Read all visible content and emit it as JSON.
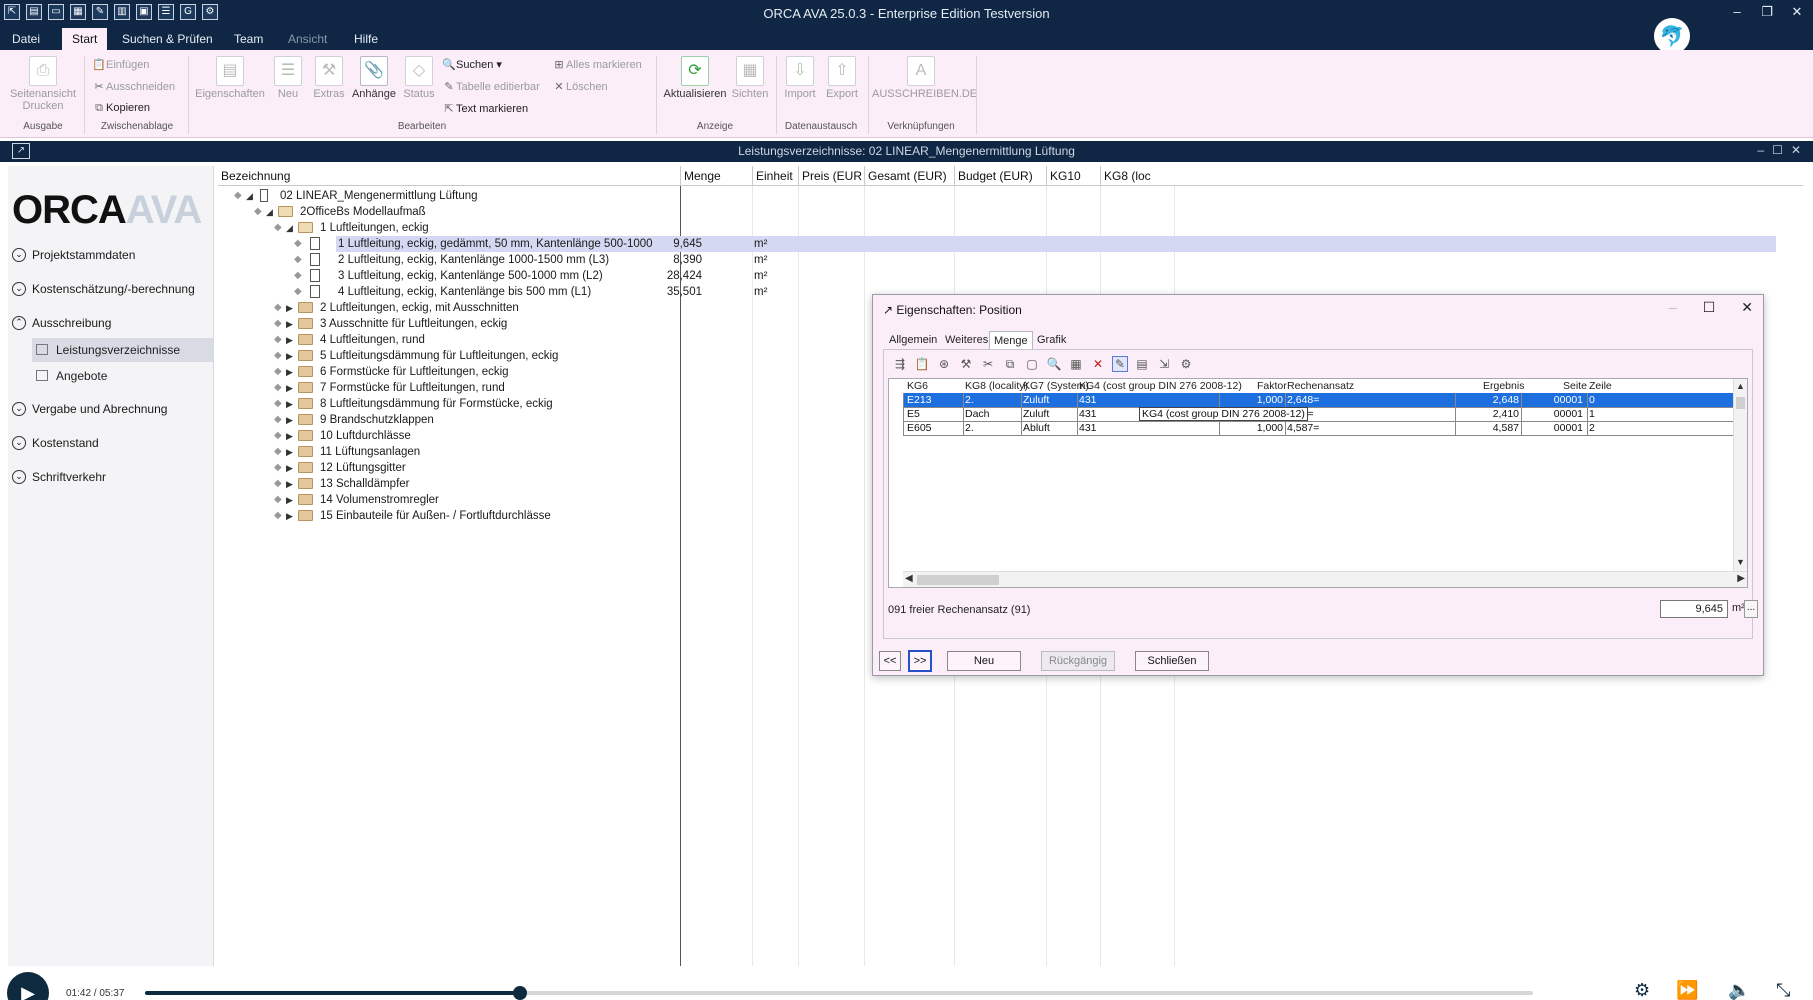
{
  "window": {
    "title": "ORCA AVA 25.0.3 - Enterprise Edition Testversion",
    "controls": [
      "–",
      "❐",
      "✕"
    ]
  },
  "menu": {
    "tabs": [
      {
        "label": "Datei",
        "state": "normal"
      },
      {
        "label": "Start",
        "state": "active"
      },
      {
        "label": "Suchen & Prüfen",
        "state": "normal"
      },
      {
        "label": "Team",
        "state": "normal"
      },
      {
        "label": "Ansicht",
        "state": "disabled"
      },
      {
        "label": "Hilfe",
        "state": "normal"
      }
    ]
  },
  "ribbon": {
    "seitenansicht": "Seitenansicht Drucken",
    "einfuegen": "Einfügen",
    "ausschneiden": "Ausschneiden",
    "kopieren": "Kopieren",
    "eigenschaften": "Eigenschaften",
    "neu": "Neu",
    "extras": "Extras",
    "anhaenge": "Anhänge",
    "status": "Status",
    "suchen": "Suchen",
    "tabelle": "Tabelle editierbar",
    "text_markieren": "Text markieren",
    "alles_markieren": "Alles markieren",
    "loeschen": "Löschen",
    "aktualisieren": "Aktualisieren",
    "sichten": "Sichten",
    "import": "Import",
    "export": "Export",
    "ausschreiben": "AUSSCHREIBEN.DE",
    "groups": {
      "ausgabe": "Ausgabe",
      "zwischenablage": "Zwischenablage",
      "bearbeiten": "Bearbeiten",
      "anzeige": "Anzeige",
      "datenaustausch": "Datenaustausch",
      "verknuepfungen": "Verknüpfungen"
    }
  },
  "document": {
    "title": "Leistungsverzeichnisse: 02 LINEAR_Mengenermittlung Lüftung"
  },
  "sidebar": {
    "brand_a": "ORCA",
    "brand_b": "AVA",
    "items": [
      {
        "label": "Projektstammdaten",
        "state": "collapsed"
      },
      {
        "label": "Kostenschätzung/-berechnung",
        "state": "collapsed"
      },
      {
        "label": "Ausschreibung",
        "state": "expanded"
      },
      {
        "label": "Vergabe und Abrechnung",
        "state": "collapsed"
      },
      {
        "label": "Kostenstand",
        "state": "collapsed"
      },
      {
        "label": "Schriftverkehr",
        "state": "collapsed"
      }
    ],
    "subitems": [
      {
        "label": "Leistungsverzeichnisse",
        "active": true
      },
      {
        "label": "Angebote",
        "active": false
      }
    ]
  },
  "table": {
    "columns": [
      "Bezeichnung",
      "Menge",
      "Einheit",
      "Preis (EUR",
      "Gesamt (EUR)",
      "Budget (EUR)",
      "KG10",
      "KG8 (loc"
    ],
    "root": "02 LINEAR_Mengenermittlung Lüftung",
    "level1": "2OfficeBs Modellaufmaß",
    "open_group": "1 Luftleitungen, eckig",
    "positions": [
      {
        "label": "1 Luftleitung, eckig, gedämmt, 50 mm, Kantenlänge 500-1000",
        "menge": "9,645",
        "einheit": "m²"
      },
      {
        "label": "2 Luftleitung, eckig, Kantenlänge 1000-1500 mm (L3)",
        "menge": "8,390",
        "einheit": "m²"
      },
      {
        "label": "3 Luftleitung, eckig, Kantenlänge 500-1000 mm (L2)",
        "menge": "28,424",
        "einheit": "m²"
      },
      {
        "label": "4 Luftleitung, eckig, Kantenlänge bis 500 mm (L1)",
        "menge": "35,501",
        "einheit": "m²"
      }
    ],
    "groups": [
      "2 Luftleitungen, eckig, mit Ausschnitten",
      "3 Ausschnitte für Luftleitungen, eckig",
      "4 Luftleitungen, rund",
      "5 Luftleitungsdämmung für Luftleitungen, eckig",
      "6 Formstücke für Luftleitungen, eckig",
      "7 Formstücke für Luftleitungen, rund",
      "8 Luftleitungsdämmung für Formstücke, eckig",
      "9 Brandschutzklappen",
      "10 Luftdurchlässe",
      "11 Lüftungsanlagen",
      "12 Lüftungsgitter",
      "13 Schalldämpfer",
      "14 Volumenstromregler",
      "15 Einbauteile für Außen- / Fortluftdurchlässe"
    ]
  },
  "dialog": {
    "title": "Eigenschaften: Position",
    "tabs": [
      "Allgemein",
      "Weiteres",
      "Menge",
      "Grafik"
    ],
    "active_tab": "Menge",
    "grid_headers": [
      "KG6",
      "KG8 (locality)",
      "KG7 (System)",
      "KG4 (cost group DIN 276 2008-12)",
      "Faktor",
      "Rechenansatz",
      "Ergebnis",
      "Seite",
      "Zeile"
    ],
    "rows": [
      {
        "kg6": "E213",
        "kg8": "2.",
        "kg7": "Zuluft",
        "kg4": "431",
        "faktor": "1,000",
        "ansatz": "2,648=",
        "ergebnis": "2,648",
        "seite": "00001",
        "zeile": "0",
        "selected": true
      },
      {
        "kg6": "E5",
        "kg8": "Dach",
        "kg7": "Zuluft",
        "kg4": "431",
        "faktor": "1,000",
        "ansatz": "2,41=",
        "ergebnis": "2,410",
        "seite": "00001",
        "zeile": "1",
        "selected": false
      },
      {
        "kg6": "E605",
        "kg8": "2.",
        "kg7": "Abluft",
        "kg4": "431",
        "faktor": "1,000",
        "ansatz": "4,587=",
        "ergebnis": "4,587",
        "seite": "00001",
        "zeile": "2",
        "selected": false
      }
    ],
    "tooltip": "KG4 (cost group DIN 276 2008-12)",
    "formula": "091 freier Rechenansatz (91)",
    "result": "9,645",
    "result_unit": "m²",
    "dots": "...",
    "buttons": {
      "prev": "<<",
      "next": ">>",
      "neu": "Neu",
      "rueck": "Rückgängig",
      "schliessen": "Schließen"
    }
  },
  "player": {
    "time": "01:42 / 05:37",
    "progress": 0.27
  }
}
